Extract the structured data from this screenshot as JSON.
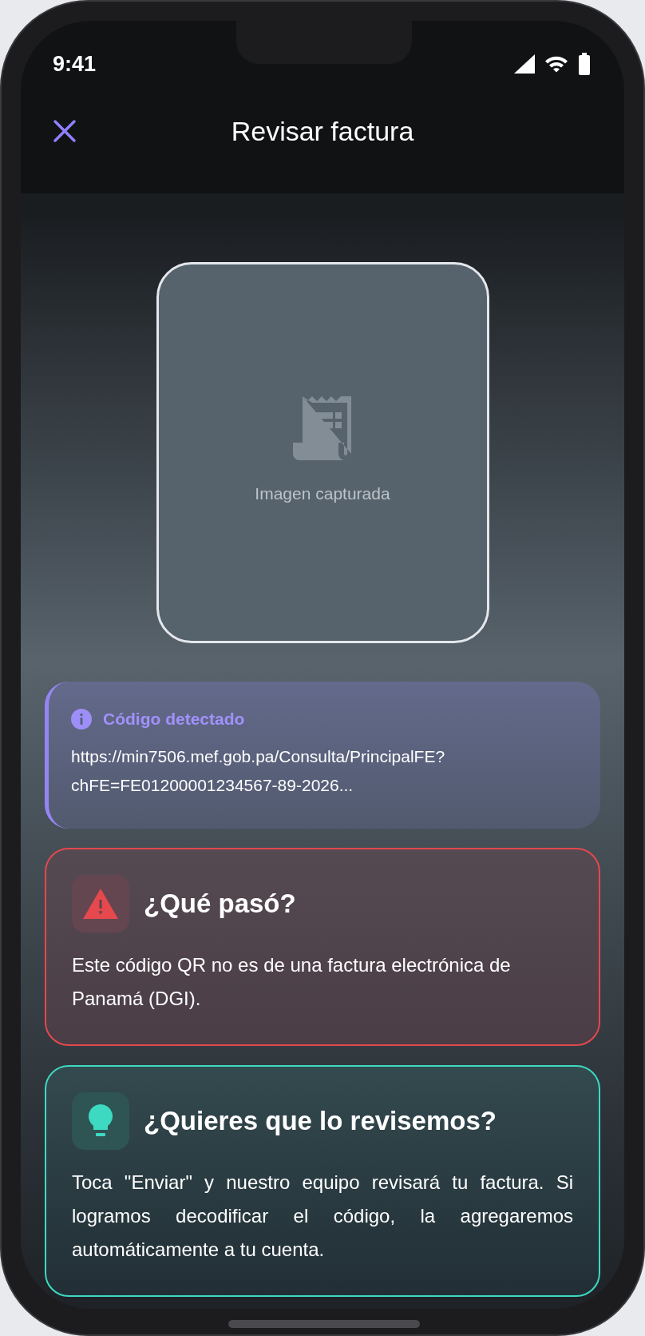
{
  "status_bar": {
    "time": "9:41"
  },
  "header": {
    "title": "Revisar factura"
  },
  "captured_image": {
    "caption": "Imagen capturada"
  },
  "detected_code": {
    "title": "Código detectado",
    "text": "https://min7506.mef.gob.pa/Consulta/PrincipalFE?chFE=FE01200001234567-89-2026..."
  },
  "cards": [
    {
      "kind": "error",
      "title": "¿Qué pasó?",
      "text": "Este código QR no es de una factura electrónica de Panamá (DGI)."
    },
    {
      "kind": "tip",
      "title": "¿Quieres que lo revisemos?",
      "text": "Toca \"Enviar\" y nuestro equipo revisará tu factura. Si logramos decodificar el código, la agregaremos automáticamente a tu cuenta."
    }
  ]
}
